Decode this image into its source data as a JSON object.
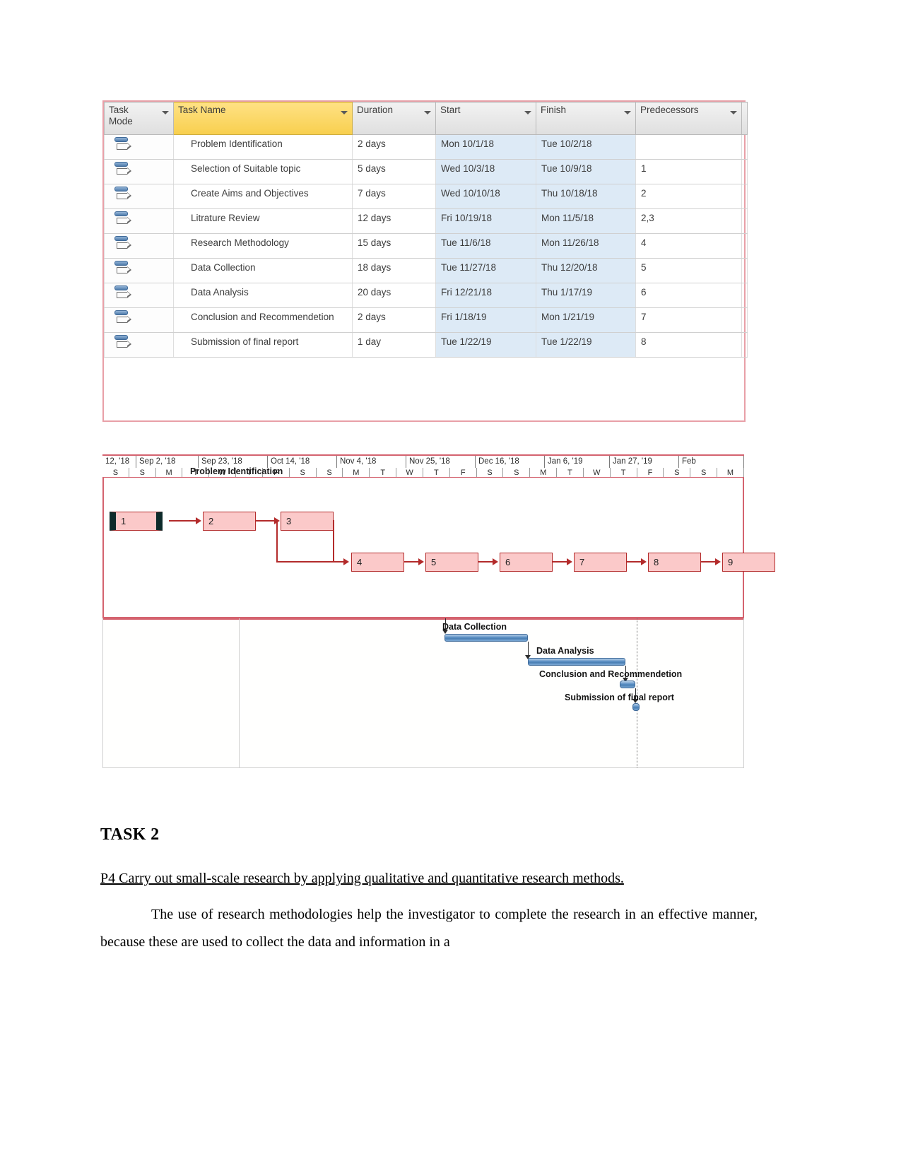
{
  "project_table": {
    "columns": [
      {
        "key": "mode",
        "label": "Task\nMode",
        "label_line1": "Task",
        "label_line2": "Mode",
        "filter": true,
        "highlight": false
      },
      {
        "key": "name",
        "label": "Task Name",
        "filter": true,
        "highlight": true
      },
      {
        "key": "duration",
        "label": "Duration",
        "filter": true,
        "highlight": false
      },
      {
        "key": "start",
        "label": "Start",
        "filter": true,
        "highlight": false
      },
      {
        "key": "finish",
        "label": "Finish",
        "filter": true,
        "highlight": false
      },
      {
        "key": "predecessors",
        "label": "Predecessors",
        "filter": true,
        "highlight": false
      }
    ],
    "rows": [
      {
        "id": 1,
        "mode_icon": "auto-schedule-icon",
        "name": "Problem Identification",
        "duration": "2 days",
        "start": "Mon 10/1/18",
        "finish": "Tue 10/2/18",
        "predecessors": ""
      },
      {
        "id": 2,
        "mode_icon": "auto-schedule-icon",
        "name": "Selection of Suitable topic",
        "duration": "5 days",
        "start": "Wed 10/3/18",
        "finish": "Tue 10/9/18",
        "predecessors": "1"
      },
      {
        "id": 3,
        "mode_icon": "auto-schedule-icon",
        "name": "Create Aims and Objectives",
        "duration": "7 days",
        "start": "Wed 10/10/18",
        "finish": "Thu 10/18/18",
        "predecessors": "2"
      },
      {
        "id": 4,
        "mode_icon": "auto-schedule-icon",
        "name": "Litrature Review",
        "duration": "12 days",
        "start": "Fri 10/19/18",
        "finish": "Mon 11/5/18",
        "predecessors": "2,3"
      },
      {
        "id": 5,
        "mode_icon": "auto-schedule-icon",
        "name": "Research Methodology",
        "duration": "15 days",
        "start": "Tue 11/6/18",
        "finish": "Mon 11/26/18",
        "predecessors": "4"
      },
      {
        "id": 6,
        "mode_icon": "auto-schedule-icon",
        "name": "Data Collection",
        "duration": "18 days",
        "start": "Tue 11/27/18",
        "finish": "Thu 12/20/18",
        "predecessors": "5"
      },
      {
        "id": 7,
        "mode_icon": "auto-schedule-icon",
        "name": "Data Analysis",
        "duration": "20 days",
        "start": "Fri 12/21/18",
        "finish": "Thu 1/17/19",
        "predecessors": "6"
      },
      {
        "id": 8,
        "mode_icon": "auto-schedule-icon",
        "name": "Conclusion and Recommendetion",
        "duration": "2 days",
        "start": "Fri 1/18/19",
        "finish": "Mon 1/21/19",
        "predecessors": "7"
      },
      {
        "id": 9,
        "mode_icon": "auto-schedule-icon",
        "name": "Submission of final report",
        "duration": "1 day",
        "start": "Tue 1/22/19",
        "finish": "Tue 1/22/19",
        "predecessors": "8"
      }
    ]
  },
  "timeline": {
    "months": [
      "12, '18",
      "Sep 2, '18",
      "Sep 23, '18",
      "Oct 14, '18",
      "Nov 4, '18",
      "Nov 25, '18",
      "Dec 16, '18",
      "Jan 6, '19",
      "Jan 27, '19",
      "Feb"
    ],
    "days": [
      "S",
      "S",
      "M",
      "T",
      "W",
      "T",
      "F",
      "S",
      "S",
      "M",
      "T",
      "W",
      "T",
      "F",
      "S",
      "S",
      "M",
      "T",
      "W",
      "T",
      "F",
      "S",
      "S",
      "M"
    ]
  },
  "network_diagram": {
    "floating_label": "Problem Identification",
    "nodes": [
      {
        "id": "1",
        "label": "1",
        "critical": true
      },
      {
        "id": "2",
        "label": "2",
        "critical": false
      },
      {
        "id": "3",
        "label": "3",
        "critical": false
      },
      {
        "id": "4",
        "label": "4",
        "critical": false
      },
      {
        "id": "5",
        "label": "5",
        "critical": false
      },
      {
        "id": "6",
        "label": "6",
        "critical": false
      },
      {
        "id": "7",
        "label": "7",
        "critical": false
      },
      {
        "id": "8",
        "label": "8",
        "critical": false
      },
      {
        "id": "9",
        "label": "9",
        "critical": false
      }
    ]
  },
  "gantt": {
    "bars": [
      {
        "task": "Data Collection",
        "label": "Data Collection"
      },
      {
        "task": "Data Analysis",
        "label": "Data Analysis"
      },
      {
        "task": "Conclusion and Recommendetion",
        "label": "Conclusion and Recommendetion"
      },
      {
        "task": "Submission of final report",
        "label": "Submission of final report"
      }
    ]
  },
  "document": {
    "heading": "TASK 2",
    "subheading": "P4 Carry out small-scale research by applying qualitative and quantitative research methods.",
    "paragraph": "The use of research methodologies help the investigator to complete the research in an effective manner, because these are used to collect the data and information in a"
  },
  "colors": {
    "header_gold": "#f8cf4e",
    "selection_blue": "#ddeaf6",
    "network_box_fill": "#fbc9c9",
    "network_box_border": "#b32b2b",
    "gantt_bar_blue": "#5b8fc4",
    "frame_red": "#d4636f"
  }
}
